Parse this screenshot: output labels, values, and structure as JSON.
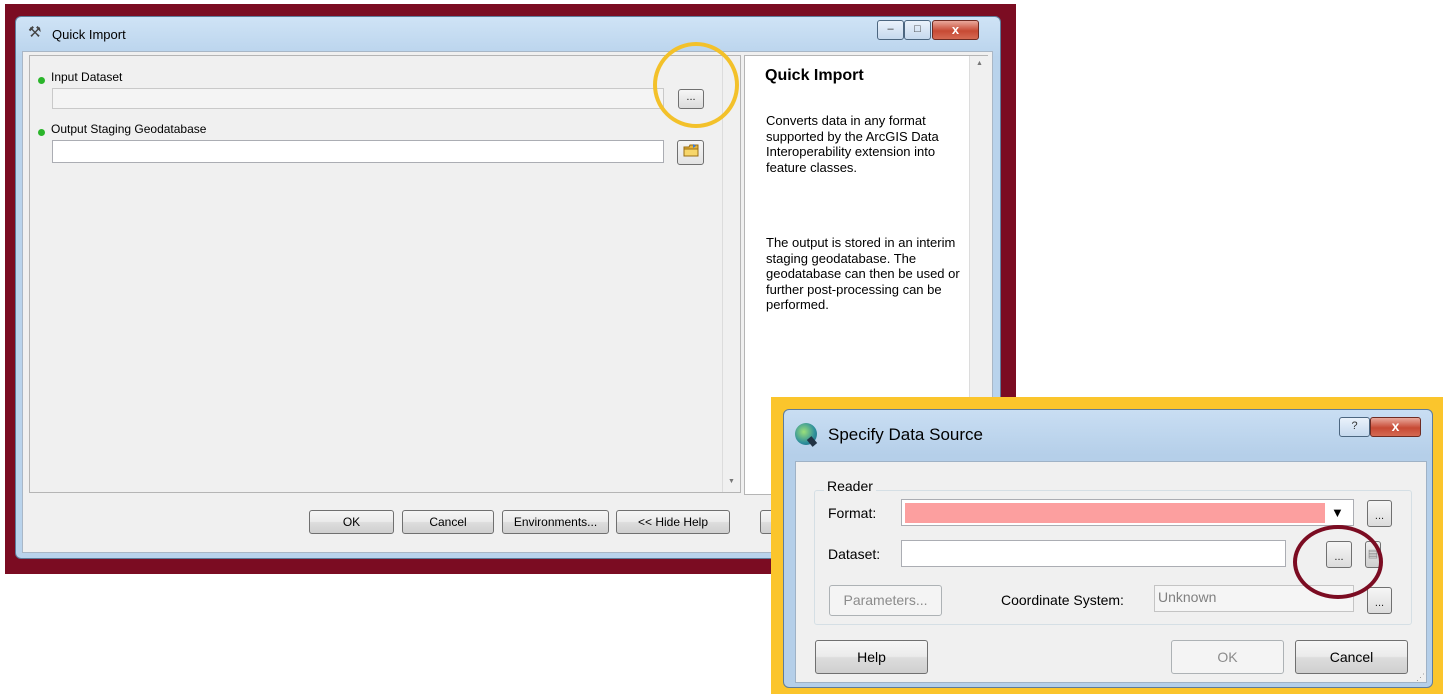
{
  "quick_import": {
    "title": "Quick Import",
    "window_controls": {
      "minimize": "–",
      "maximize": "□",
      "close": "x"
    },
    "params": {
      "input_label": "Input Dataset",
      "input_value": "",
      "input_browse": "...",
      "output_label": "Output Staging Geodatabase",
      "output_value": ""
    },
    "help": {
      "title": "Quick Import",
      "p1": "Converts data in any format supported by the ArcGIS Data Interoperability extension into feature classes.",
      "p2": "The output is stored in an interim staging geodatabase. The geodatabase can then be used or further post-processing can be performed."
    },
    "buttons": {
      "ok": "OK",
      "cancel": "Cancel",
      "environments": "Environments...",
      "hide_help": "<< Hide Help"
    }
  },
  "specify_data_source": {
    "title": "Specify Data Source",
    "controls": {
      "help": "?",
      "close": "x"
    },
    "reader": {
      "legend": "Reader",
      "format_label": "Format:",
      "format_value": "",
      "dataset_label": "Dataset:",
      "dataset_value": "",
      "browse": "...",
      "parameters": "Parameters...",
      "coord_label": "Coordinate System:",
      "coord_value": "Unknown"
    },
    "buttons": {
      "help": "Help",
      "ok": "OK",
      "cancel": "Cancel"
    }
  },
  "colors": {
    "maroon_frame": "#7b0c22",
    "gold_frame": "#fbc52c",
    "format_highlight": "#fc9f9f",
    "required_dot": "#2bb52b"
  }
}
